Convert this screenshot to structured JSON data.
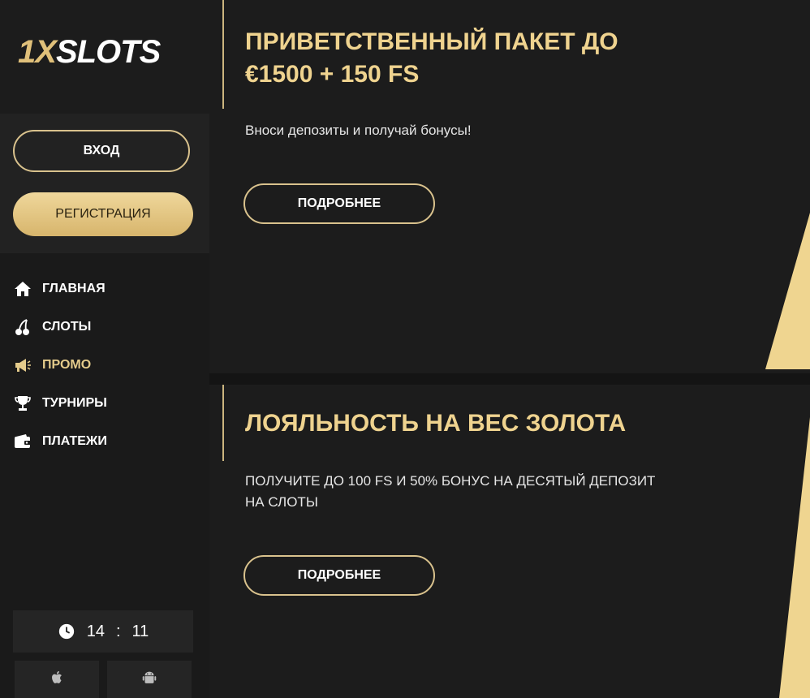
{
  "brand": {
    "logo_accent": "1X",
    "logo_rest": "SLOTS"
  },
  "auth": {
    "login_label": "ВХОД",
    "register_label": "РЕГИСТРАЦИЯ"
  },
  "nav": {
    "items": [
      {
        "label": "ГЛАВНАЯ",
        "icon": "home-icon",
        "active": false
      },
      {
        "label": "СЛОТЫ",
        "icon": "cherry-icon",
        "active": false
      },
      {
        "label": "ПРОМО",
        "icon": "megaphone-icon",
        "active": true
      },
      {
        "label": "ТУРНИРЫ",
        "icon": "trophy-icon",
        "active": false
      },
      {
        "label": "ПЛАТЕЖИ",
        "icon": "wallet-icon",
        "active": false
      }
    ]
  },
  "clock": {
    "hours": "14",
    "separator": ":",
    "minutes": "11"
  },
  "apps": {
    "ios_icon": "apple-icon",
    "android_icon": "android-icon"
  },
  "promos": [
    {
      "title_line1": "ПРИВЕТСТВЕННЫЙ ПАКЕТ ДО",
      "title_line2": "€1500 + 150 FS",
      "description": "Вноси депозиты и получай бонусы!",
      "button_label": "ПОДРОБНЕЕ"
    },
    {
      "title_line1": "ЛОЯЛЬНОСТЬ НА ВЕС ЗОЛОТА",
      "description_line1": "ПОЛУЧИТЕ ДО 100 FS И 50% БОНУС НА ДЕСЯТЫЙ ДЕПОЗИТ",
      "description_line2": "НА СЛОТЫ",
      "button_label": "ПОДРОБНЕЕ"
    }
  ],
  "colors": {
    "gold": "#e0c07a",
    "gold_title": "#efd38f",
    "background": "#141414",
    "panel": "#1c1c1c"
  }
}
